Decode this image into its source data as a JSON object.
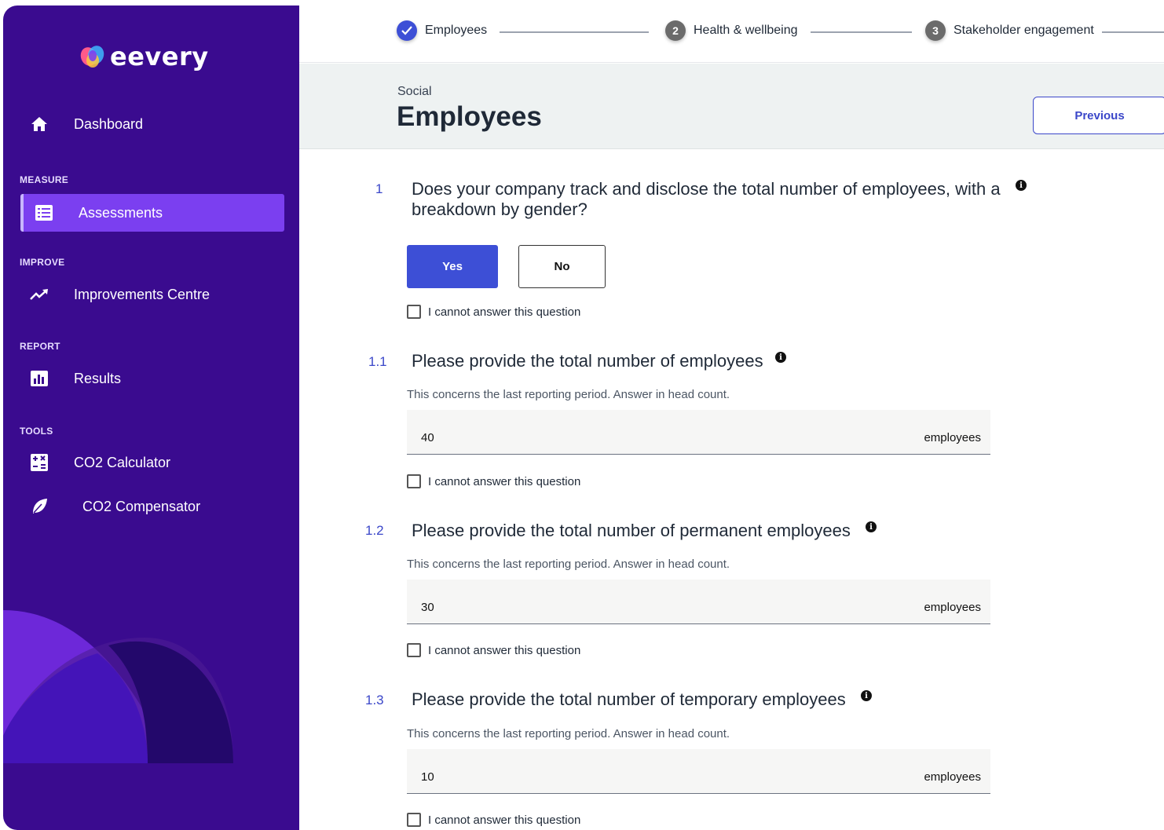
{
  "app": {
    "name": "eevery"
  },
  "sidebar": {
    "dashboard": "Dashboard",
    "sections": {
      "measure": "MEASURE",
      "improve": "IMPROVE",
      "report": "REPORT",
      "tools": "TOOLS"
    },
    "items": {
      "assessments": "Assessments",
      "improvements": "Improvements Centre",
      "results": "Results",
      "co2_calculator": "CO2 Calculator",
      "co2_compensator": "CO2 Compensator"
    },
    "icons": [
      "home-icon",
      "list-icon",
      "trending-up-icon",
      "bar-chart-icon",
      "calculator-icon",
      "leaf-icon"
    ]
  },
  "stepper": {
    "steps": [
      {
        "number": "",
        "label": "Employees",
        "status": "complete"
      },
      {
        "number": "2",
        "label": "Health & wellbeing",
        "status": "pending"
      },
      {
        "number": "3",
        "label": "Stakeholder engagement",
        "status": "pending"
      }
    ]
  },
  "header": {
    "breadcrumb": "Social",
    "title": "Employees",
    "previous_label": "Previous"
  },
  "questions": [
    {
      "number": "1",
      "text": "Does your company track and disclose the total number of employees, with a breakdown by gender?",
      "yes_label": "Yes",
      "no_label": "No",
      "selected": "Yes",
      "cannot_label": "I cannot answer this question"
    },
    {
      "number": "1.1",
      "text": "Please provide the total number of employees",
      "hint": "This concerns the last reporting period. Answer in head count.",
      "value": "40",
      "unit": "employees",
      "cannot_label": "I cannot answer this question"
    },
    {
      "number": "1.2",
      "text": "Please provide the total number of permanent employees",
      "hint": "This concerns the last reporting period. Answer in head count.",
      "value": "30",
      "unit": "employees",
      "cannot_label": "I cannot answer this question"
    },
    {
      "number": "1.3",
      "text": "Please provide the total number of temporary employees",
      "hint": "This concerns the last reporting period. Answer in head count.",
      "value": "10",
      "unit": "employees",
      "cannot_label": "I cannot answer this question"
    }
  ],
  "colors": {
    "sidebar_bg": "#3a0b8f",
    "active_item": "#7b3ff0",
    "accent": "#3d4fd6",
    "step_complete": "#3d4fd6",
    "step_pending": "#6b6b6b"
  }
}
